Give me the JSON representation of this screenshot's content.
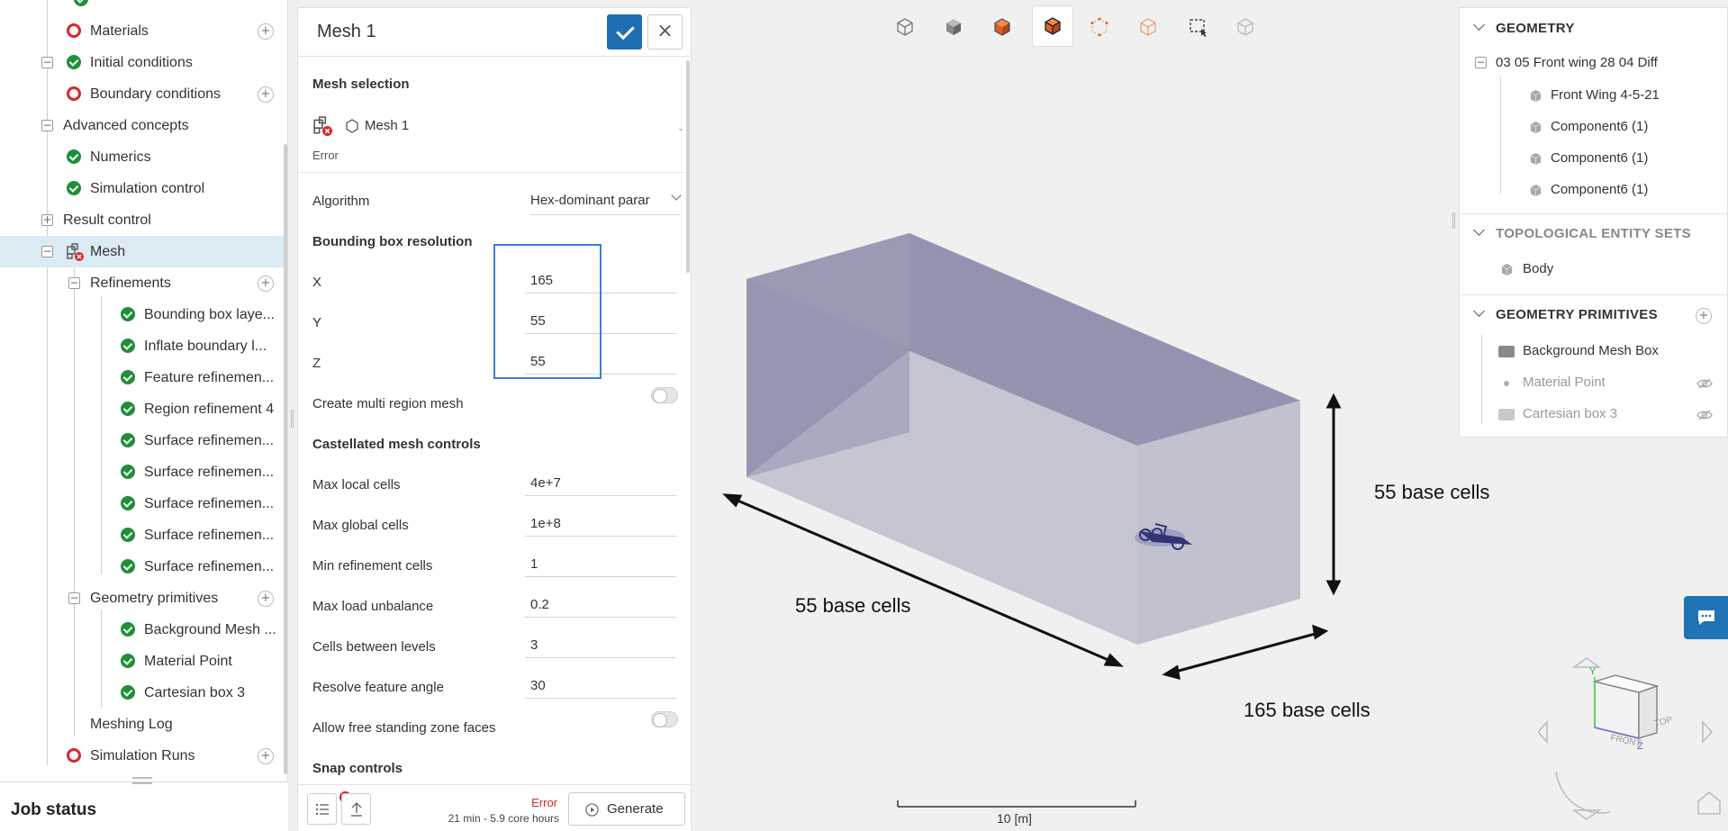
{
  "tree": {
    "items": [
      {
        "label": "Materials",
        "status": "error",
        "add": true
      },
      {
        "label": "Initial conditions",
        "status": "ok"
      },
      {
        "label": "Boundary conditions",
        "status": "error",
        "add": true
      },
      {
        "label": "Advanced concepts"
      },
      {
        "label": "Numerics",
        "status": "ok"
      },
      {
        "label": "Simulation control",
        "status": "ok"
      },
      {
        "label": "Result control"
      },
      {
        "label": "Mesh",
        "status": "mesh-error"
      },
      {
        "label": "Refinements",
        "add": true
      },
      {
        "label": "Bounding box laye...",
        "status": "ok"
      },
      {
        "label": "Inflate boundary l...",
        "status": "ok"
      },
      {
        "label": "Feature refinemen...",
        "status": "ok"
      },
      {
        "label": "Region refinement 4",
        "status": "ok"
      },
      {
        "label": "Surface refinemen...",
        "status": "ok"
      },
      {
        "label": "Surface refinemen...",
        "status": "ok"
      },
      {
        "label": "Surface refinemen...",
        "status": "ok"
      },
      {
        "label": "Surface refinemen...",
        "status": "ok"
      },
      {
        "label": "Surface refinemen...",
        "status": "ok"
      },
      {
        "label": "Geometry primitives",
        "add": true
      },
      {
        "label": "Background Mesh ...",
        "status": "ok"
      },
      {
        "label": "Material Point",
        "status": "ok"
      },
      {
        "label": "Cartesian box 3",
        "status": "ok"
      },
      {
        "label": "Meshing Log"
      },
      {
        "label": "Simulation Runs",
        "status": "error",
        "add": true
      }
    ],
    "job_status": "Job status"
  },
  "panel": {
    "title": "Mesh 1",
    "mesh_selection_title": "Mesh selection",
    "mesh_name": "Mesh 1",
    "mesh_state": "Error",
    "algorithm_label": "Algorithm",
    "algorithm_value": "Hex-dominant parar",
    "bbox_title": "Bounding box resolution",
    "x_label": "X",
    "x_value": "165",
    "y_label": "Y",
    "y_value": "55",
    "z_label": "Z",
    "z_value": "55",
    "multi_region_label": "Create multi region mesh",
    "castellated_title": "Castellated mesh controls",
    "max_local_label": "Max local cells",
    "max_local_value": "4e+7",
    "max_global_label": "Max global cells",
    "max_global_value": "1e+8",
    "min_ref_label": "Min refinement cells",
    "min_ref_value": "1",
    "max_load_label": "Max load unbalance",
    "max_load_value": "0.2",
    "cells_between_label": "Cells between levels",
    "cells_between_value": "3",
    "resolve_label": "Resolve feature angle",
    "resolve_value": "30",
    "free_standing_label": "Allow free standing zone faces",
    "snap_title": "Snap controls",
    "footer_status": "Error",
    "footer_estimate": "21 min - 5.9 core hours",
    "generate_label": "Generate"
  },
  "right_panel": {
    "geometry_title": "GEOMETRY",
    "geometry_root": "03 05 Front wing 28 04 Diff",
    "geometry_items": [
      "Front Wing 4-5-21",
      "Component6 (1)",
      "Component6 (1)",
      "Component6 (1)"
    ],
    "tes_title": "TOPOLOGICAL ENTITY SETS",
    "tes_items": [
      "Body"
    ],
    "prim_title": "GEOMETRY PRIMITIVES",
    "prim_items": [
      "Background Mesh Box",
      "Material Point",
      "Cartesian box 3"
    ]
  },
  "viewport": {
    "annot_left": "55 base cells",
    "annot_right": "55 base cells",
    "annot_bottom": "165 base cells",
    "scale": "10 [m]",
    "box_color": "#9494b0",
    "box_side_color": "#c4c4d0",
    "arrow_color": "#111111"
  },
  "colors": {
    "accent": "#1f6fb2",
    "ok": "#1f8f3a",
    "error": "#d9262d",
    "selected_row": "#dbeaf3"
  }
}
